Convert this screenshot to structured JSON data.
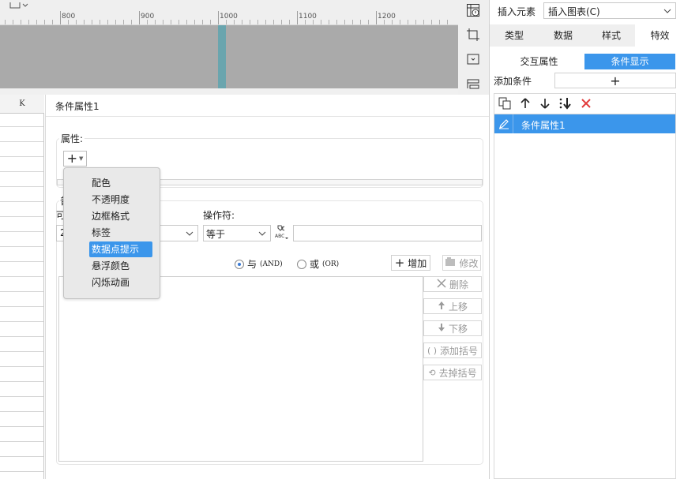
{
  "ruler": {
    "labels": [
      "800",
      "900",
      "1000",
      "1100",
      "1200"
    ]
  },
  "sheet": {
    "column_header": "K"
  },
  "main": {
    "title": "条件属性1",
    "attr_label": "属性:",
    "cond_label_partial": "普",
    "var_label_partial": "可",
    "combo_left_value": "2",
    "operator_label": "操作符:",
    "operator_value": "等于",
    "value_input": "",
    "radio_and": "与",
    "radio_and_tag": "(AND)",
    "radio_or": "或",
    "radio_or_tag": "(OR)",
    "buttons": {
      "add": "增加",
      "modify": "修改",
      "delete": "删除",
      "move_up": "上移",
      "move_down": "下移",
      "add_bracket": "添加括号",
      "remove_bracket": "去掉括号"
    }
  },
  "popup": {
    "items": [
      "配色",
      "不透明度",
      "边框格式",
      "标签",
      "数据点提示",
      "悬浮颜色",
      "闪烁动画"
    ],
    "selected": "数据点提示"
  },
  "right": {
    "insert_label": "插入元素",
    "insert_value": "插入图表(C)",
    "tabs": [
      "类型",
      "数据",
      "样式",
      "特效"
    ],
    "active_tab": "特效",
    "sub_tabs": [
      "交互属性",
      "条件显示"
    ],
    "active_sub_tab": "条件显示",
    "add_condition_label": "添加条件",
    "conditions": [
      "条件属性1"
    ]
  },
  "colors": {
    "accent": "#3b96eb",
    "canvas_gray": "#aaaaaa",
    "marker": "#6aa5ae",
    "delete_red": "#e23b3b"
  }
}
